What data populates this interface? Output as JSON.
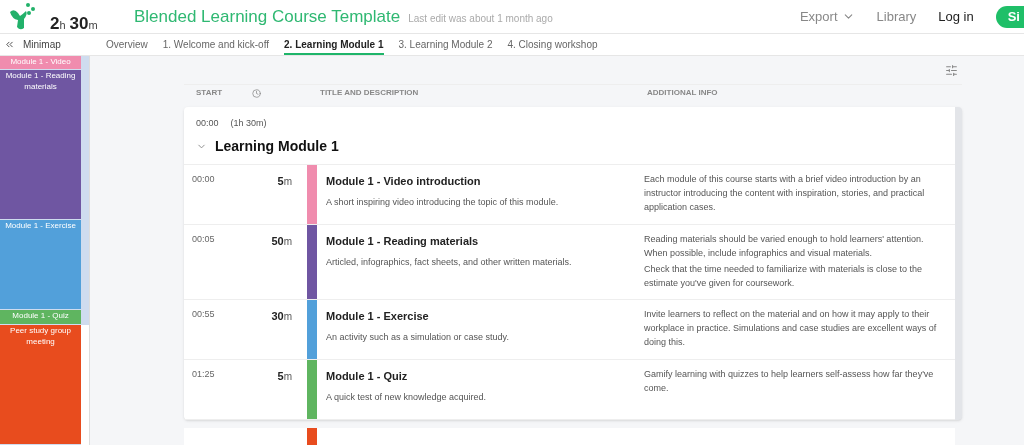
{
  "header": {
    "total_hours": "2",
    "hours_unit": "h",
    "total_minutes": "30",
    "minutes_unit": "m",
    "title": "Blended Learning Course Template",
    "last_edit": "Last edit was about 1 month ago",
    "nav": [
      {
        "label": "Export",
        "kind": "dropdown"
      },
      {
        "label": "Library",
        "kind": "link"
      },
      {
        "label": "Log in",
        "kind": "strong"
      },
      {
        "label": "Si",
        "kind": "button"
      }
    ]
  },
  "minimap": {
    "label": "Minimap",
    "items": [
      {
        "label": "Module 1 - Video",
        "color": "#f08cae"
      },
      {
        "label": "Module 1 - Reading materials",
        "color": "#6f56a2"
      },
      {
        "label": "Module 1 - Exercise",
        "color": "#52a0da"
      },
      {
        "label": "Module 1 - Quiz",
        "color": "#5fb560"
      },
      {
        "label": "Peer study group meeting",
        "color": "#e84c1e"
      }
    ]
  },
  "tabs": [
    {
      "label": "Overview",
      "selected": false
    },
    {
      "label": "1. Welcome and kick-off",
      "selected": false
    },
    {
      "label": "2. Learning Module 1",
      "selected": true
    },
    {
      "label": "3. Learning Module 2",
      "selected": false
    },
    {
      "label": "4. Closing workshop",
      "selected": false
    }
  ],
  "table": {
    "columns": [
      "START",
      "TITLE AND DESCRIPTION",
      "ADDITIONAL INFO"
    ],
    "section": {
      "start": "00:00",
      "length": "(1h 30m)",
      "title": "Learning Module 1",
      "expanded": true
    },
    "rows": [
      {
        "start": "00:00",
        "duration": "5",
        "unit": "m",
        "color": "#f08cae",
        "title": "Module 1 - Video introduction",
        "description": "A short inspiring video introducing the topic of this module.",
        "info": [
          "Each module of this course starts with a brief video introduction by an instructor introducing the content with inspiration, stories, and practical application cases."
        ]
      },
      {
        "start": "00:05",
        "duration": "50",
        "unit": "m",
        "color": "#6f56a2",
        "title": "Module 1 - Reading materials",
        "description": "Articled, infographics, fact sheets, and other written materials.",
        "info": [
          "Reading materials should be varied enough to hold learners' attention. When possible, include infographics and visual materials.",
          "Check that the time needed to familiarize with materials is close to the estimate you've given for coursework."
        ]
      },
      {
        "start": "00:55",
        "duration": "30",
        "unit": "m",
        "color": "#52a0da",
        "title": "Module 1 - Exercise",
        "description": "An activity such as a simulation or case study.",
        "info": [
          "Invite learners to reflect on the material and on how it may apply to their workplace in practice. Simulations and case studies are excellent ways of doing this."
        ]
      },
      {
        "start": "01:25",
        "duration": "5",
        "unit": "m",
        "color": "#5fb560",
        "title": "Module 1 - Quiz",
        "description": "A quick test of new knowledge acquired.",
        "info": [
          "Gamify learning with quizzes to help learners self-assess how far they've come."
        ]
      }
    ]
  }
}
